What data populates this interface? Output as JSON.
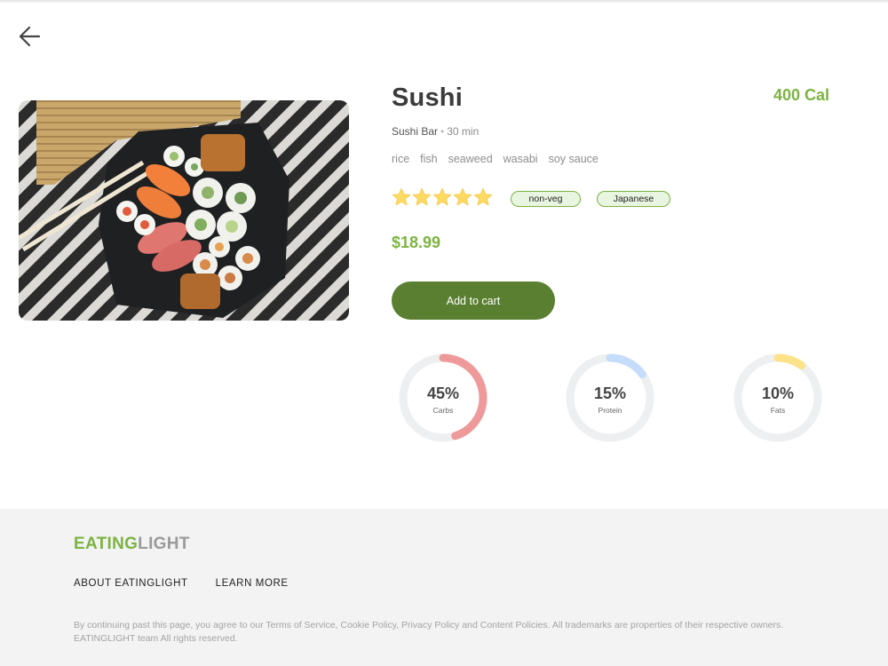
{
  "nav": {
    "back_icon": "arrow-left-icon"
  },
  "product": {
    "title": "Sushi",
    "calories": "400 Cal",
    "restaurant": "Sushi Bar",
    "separator": "•",
    "time": "30 min",
    "ingredients": [
      "rice",
      "fish",
      "seaweed",
      "wasabi",
      "soy sauce"
    ],
    "rating": 5,
    "rating_max": 5,
    "tags": [
      "non-veg",
      "Japanese"
    ],
    "price": "$18.99",
    "cart_label": "Add to cart",
    "image_icon": "sushi-platter-photo"
  },
  "nutrition": [
    {
      "percent": "45%",
      "value": 45,
      "label": "Carbs",
      "color": "#ef9a9a"
    },
    {
      "percent": "15%",
      "value": 15,
      "label": "Protein",
      "color": "#c5dcfa"
    },
    {
      "percent": "10%",
      "value": 10,
      "label": "Fats",
      "color": "#fce38a"
    }
  ],
  "colors": {
    "accent": "#7cb342",
    "button": "#5a7f31",
    "ring_track": "#eeeff1"
  },
  "footer": {
    "brand_part1": "EATING",
    "brand_part2": "LIGHT",
    "links": [
      "ABOUT EATINGLIGHT",
      "LEARN MORE"
    ],
    "legal_line1": "By continuing past this page, you agree to our Terms of Service, Cookie Policy, Privacy Policy and Content Policies. All trademarks are properties of their respective owners.",
    "legal_line2": "EATINGLIGHT team All rights reserved."
  }
}
